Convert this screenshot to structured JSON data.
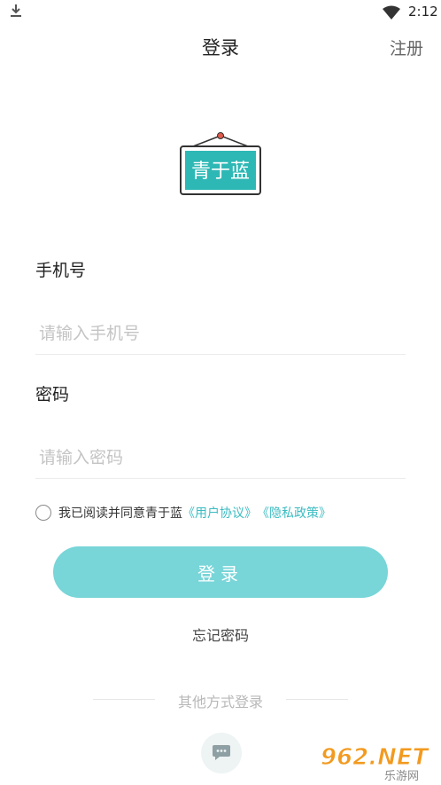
{
  "status_bar": {
    "time": "2:12",
    "icons": [
      "download-icon",
      "wifi-icon"
    ]
  },
  "header": {
    "title": "登录",
    "register_label": "注册"
  },
  "logo": {
    "text": "青于蓝",
    "colors": {
      "frame": "#333333",
      "board": "#2eb8b5",
      "text": "#ffffff"
    }
  },
  "phone": {
    "label": "手机号",
    "placeholder": "请输入手机号",
    "value": ""
  },
  "password": {
    "label": "密码",
    "placeholder": "请输入密码",
    "value": ""
  },
  "agreement": {
    "checked": false,
    "text": "我已阅读并同意青于蓝",
    "user_agreement": "《用户协议》",
    "privacy_policy": "《隐私政策》"
  },
  "login_button": {
    "label": "登录"
  },
  "forgot_password": "忘记密码",
  "other_login": {
    "label": "其他方式登录",
    "icons": [
      "message-icon"
    ]
  },
  "watermark": {
    "text": "962.NET",
    "subtext": "乐游网"
  },
  "colors": {
    "accent": "#78d5d8",
    "link": "#3cbcc2",
    "placeholder": "#c4c4c4"
  }
}
